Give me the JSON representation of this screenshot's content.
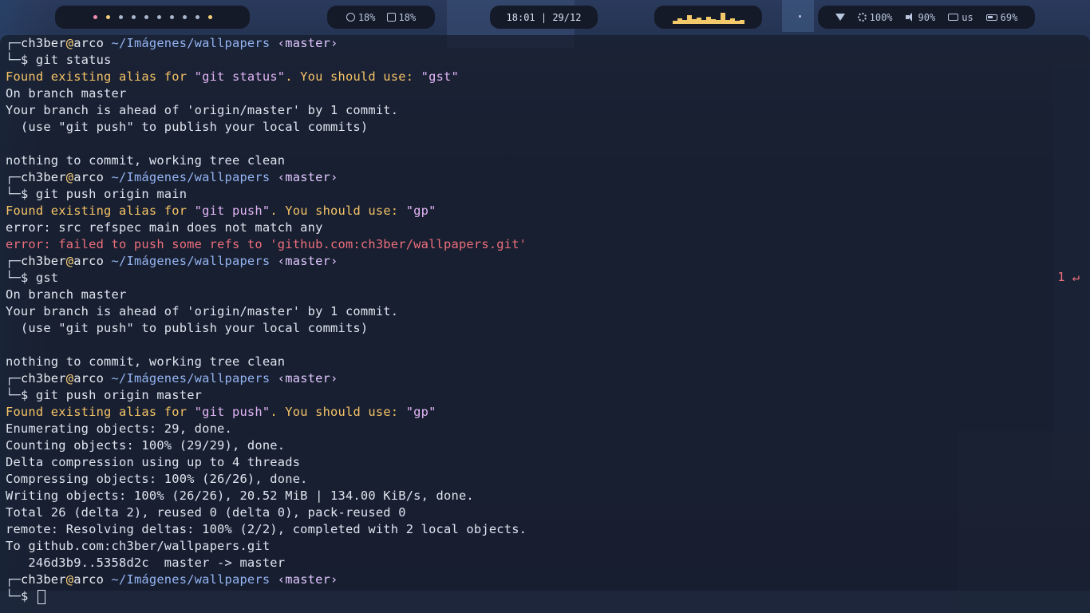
{
  "topbar": {
    "workspace_dot_colors": [
      "#f28fad",
      "#f6cf79",
      "#aab6cc",
      "#aab6cc",
      "#aab6cc",
      "#aab6cc",
      "#aab6cc",
      "#aab6cc",
      "#aab6cc",
      "#f6cf79"
    ],
    "cpu": "18%",
    "mem": "18%",
    "clock": "18:01 | 29/12",
    "visualizer_levels": [
      0.25,
      0.45,
      0.3,
      0.7,
      0.35,
      0.5,
      0.3,
      0.55,
      0.4,
      0.3,
      0.85,
      0.3,
      0.45,
      0.25,
      0.3
    ],
    "wifi_icon": "wifi-icon",
    "brightness": "100%",
    "volume": "90%",
    "keyboard_layout": "us",
    "battery": "69%",
    "accent_color": "#f4c96b"
  },
  "terminal": {
    "prompt": {
      "corner_top": "┌─",
      "corner_bottom": "└─",
      "user": "ch3ber",
      "at": "@",
      "host": "arco",
      "path": " ~/Imágenes/wallpapers ",
      "branch": "‹master›",
      "symbol": "$ "
    },
    "blocks": [
      {
        "command": "git status",
        "warning_prefix": "Found existing alias for ",
        "warning_cmd": "\"git status\"",
        "warning_mid": ". You should use: ",
        "warning_alias": "\"gst\"",
        "output": [
          "On branch master",
          "Your branch is ahead of 'origin/master' by 1 commit.",
          "  (use \"git push\" to publish your local commits)",
          "",
          "nothing to commit, working tree clean"
        ]
      },
      {
        "command": "git push origin main",
        "warning_prefix": "Found existing alias for ",
        "warning_cmd": "\"git push\"",
        "warning_mid": ". You should use: ",
        "warning_alias": "\"gp\"",
        "output": [
          "error: src refspec main does not match any"
        ],
        "error_line": "error: failed to push some refs to 'github.com:ch3ber/wallpapers.git'"
      },
      {
        "command": "gst",
        "right_prompt": "1 ↵",
        "output": [
          "On branch master",
          "Your branch is ahead of 'origin/master' by 1 commit.",
          "  (use \"git push\" to publish your local commits)",
          "",
          "nothing to commit, working tree clean"
        ]
      },
      {
        "command": "git push origin master",
        "warning_prefix": "Found existing alias for ",
        "warning_cmd": "\"git push\"",
        "warning_mid": ". You should use: ",
        "warning_alias": "\"gp\"",
        "output": [
          "Enumerating objects: 29, done.",
          "Counting objects: 100% (29/29), done.",
          "Delta compression using up to 4 threads",
          "Compressing objects: 100% (26/26), done.",
          "Writing objects: 100% (26/26), 20.52 MiB | 134.00 KiB/s, done.",
          "Total 26 (delta 2), reused 0 (delta 0), pack-reused 0",
          "remote: Resolving deltas: 100% (2/2), completed with 2 local objects.",
          "To github.com:ch3ber/wallpapers.git",
          "   246d3b9..5358d2c  master -> master"
        ]
      }
    ]
  }
}
